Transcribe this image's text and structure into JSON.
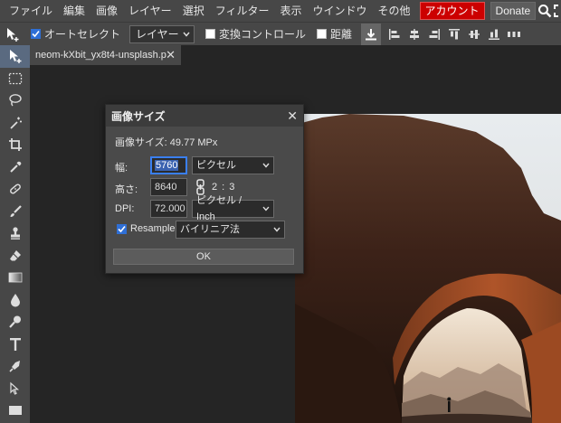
{
  "menubar": {
    "items": [
      "ファイル",
      "編集",
      "画像",
      "レイヤー",
      "選択",
      "フィルター",
      "表示",
      "ウインドウ",
      "その他"
    ],
    "account": "アカウント",
    "donate": "Donate",
    "icons": [
      "search-icon",
      "fullscreen-icon"
    ]
  },
  "options": {
    "auto_select_label": "オートセレクト",
    "auto_select_checked": true,
    "auto_select_target": "レイヤー",
    "transform_label": "変換コントロール",
    "transform_checked": false,
    "distance_label": "距離",
    "distance_checked": false
  },
  "tab": {
    "title": "neom-kXbit_yx8t4-unsplash.p",
    "close": "✕"
  },
  "tools": [
    "move-tool",
    "marquee-tool",
    "lasso-tool",
    "magic-wand-tool",
    "crop-tool",
    "eyedropper-tool",
    "healing-tool",
    "brush-tool",
    "clone-stamp-tool",
    "eraser-tool",
    "gradient-tool",
    "blur-tool",
    "dodge-tool",
    "text-tool",
    "pen-tool",
    "path-select-tool",
    "rectangle-tool"
  ],
  "dialog": {
    "title": "画像サイズ",
    "close": "✕",
    "info": "画像サイズ: 49.77 MPx",
    "width_label": "幅:",
    "width_value": "5760",
    "width_unit": "ピクセル",
    "height_label": "高さ:",
    "height_value": "8640",
    "ratio": "2 : 3",
    "dpi_label": "DPI:",
    "dpi_value": "72.000",
    "dpi_unit": "ピクセル / Inch",
    "resample_label": "Resample",
    "resample_checked": true,
    "resample_method": "バイリニア法",
    "ok_label": "OK"
  }
}
